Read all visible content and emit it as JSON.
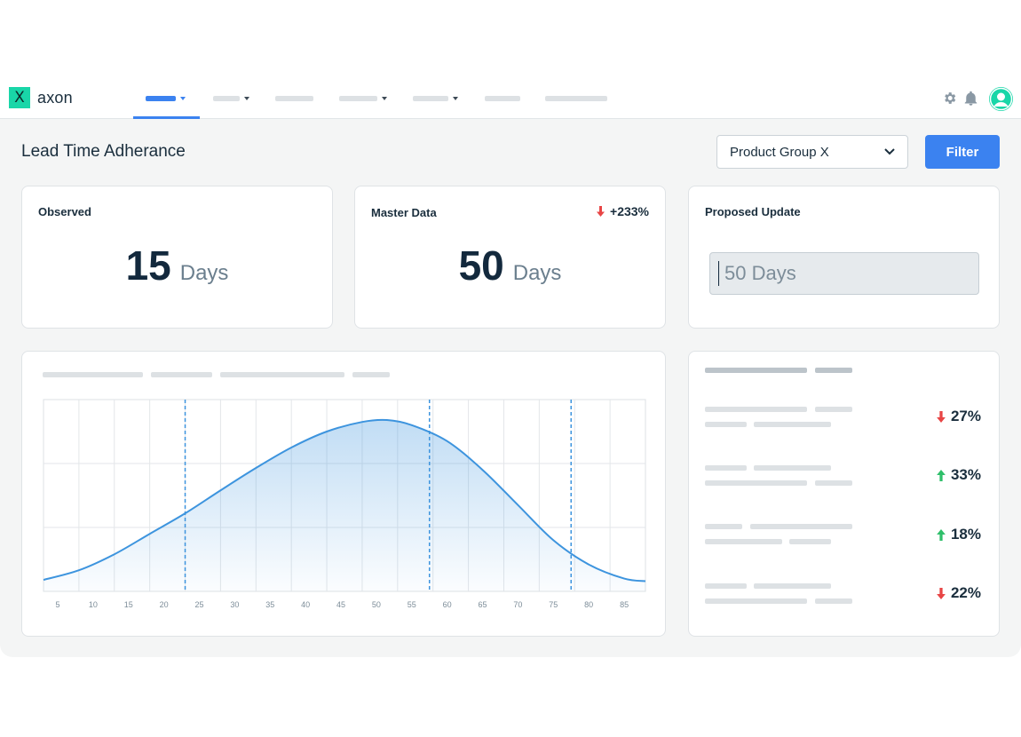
{
  "brand": {
    "logo_glyph": "X",
    "name": "axon",
    "color": "#19d6a8"
  },
  "nav": {
    "items": [
      {
        "id": "nav-1",
        "active": true,
        "has_dropdown": true
      },
      {
        "id": "nav-2",
        "active": false,
        "has_dropdown": true
      },
      {
        "id": "nav-3",
        "active": false,
        "has_dropdown": false
      },
      {
        "id": "nav-4",
        "active": false,
        "has_dropdown": true
      },
      {
        "id": "nav-5",
        "active": false,
        "has_dropdown": true
      },
      {
        "id": "nav-6",
        "active": false,
        "has_dropdown": false
      },
      {
        "id": "nav-7",
        "active": false,
        "has_dropdown": false
      }
    ],
    "icons": [
      "gear-icon",
      "bell-icon",
      "user-avatar-icon"
    ]
  },
  "header": {
    "title": "Lead Time Adherance",
    "product_select": {
      "value": "Product Group X"
    },
    "filter_label": "Filter"
  },
  "cards": {
    "observed": {
      "label": "Observed",
      "value": "15",
      "unit": "Days"
    },
    "master_data": {
      "label": "Master Data",
      "value": "50",
      "unit": "Days",
      "delta": "+233%",
      "delta_direction": "down",
      "delta_color": "#e84545"
    },
    "proposed": {
      "label": "Proposed Update",
      "input_value": "50 Days"
    }
  },
  "chart_data": {
    "type": "area",
    "x_ticks": [
      "5",
      "10",
      "15",
      "20",
      "25",
      "30",
      "35",
      "40",
      "45",
      "50",
      "55",
      "60",
      "65",
      "70",
      "75",
      "80",
      "85"
    ],
    "xlim": [
      3,
      88
    ],
    "ylim": [
      0,
      3
    ],
    "series": [
      {
        "x": [
          3,
          8,
          13,
          18,
          23,
          28,
          33,
          38,
          43,
          48,
          51.5,
          55,
          60,
          65,
          70,
          75,
          80,
          85,
          88
        ],
        "values": [
          0.18,
          0.33,
          0.58,
          0.9,
          1.22,
          1.58,
          1.93,
          2.25,
          2.5,
          2.65,
          2.68,
          2.6,
          2.35,
          1.9,
          1.35,
          0.8,
          0.42,
          0.2,
          0.16
        ]
      }
    ],
    "reference_lines_x": [
      23,
      57.5,
      77.5
    ],
    "grid": true,
    "color": "#3d94de"
  },
  "metrics": [
    {
      "value": "27%",
      "direction": "down",
      "color": "#e84545"
    },
    {
      "value": "33%",
      "direction": "up",
      "color": "#2fbf6a"
    },
    {
      "value": "18%",
      "direction": "up",
      "color": "#2fbf6a"
    },
    {
      "value": "22%",
      "direction": "down",
      "color": "#e84545"
    }
  ]
}
